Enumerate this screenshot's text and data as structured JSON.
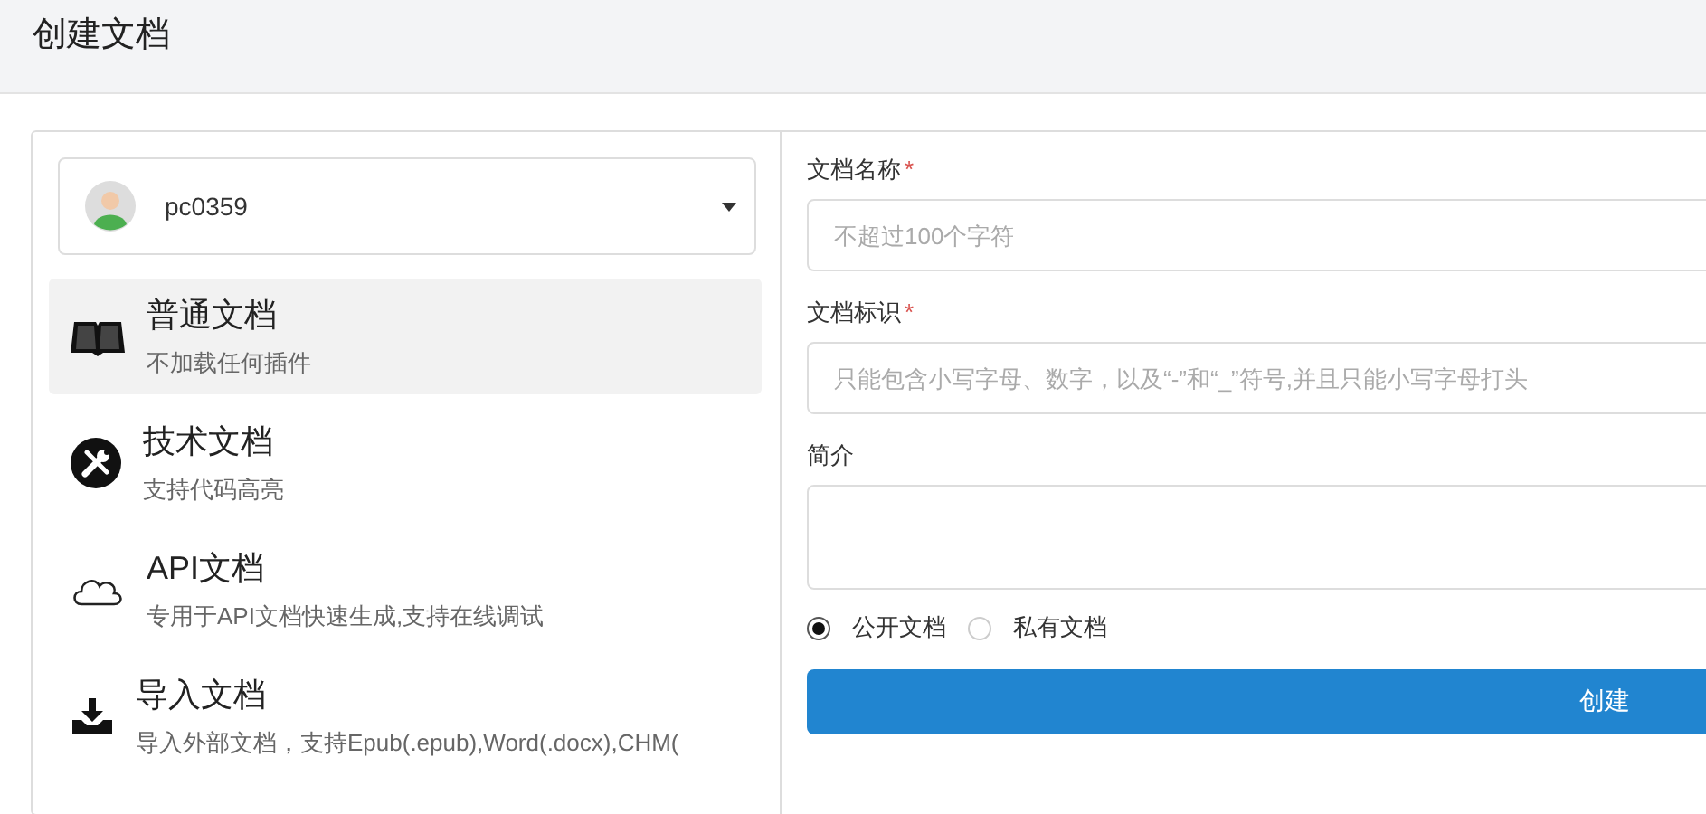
{
  "page_title": "创建文档",
  "account": {
    "name": "pc0359"
  },
  "doc_types": [
    {
      "kind": "normal",
      "title": "普通文档",
      "description": "不加载任何插件",
      "selected": true
    },
    {
      "kind": "tech",
      "title": "技术文档",
      "description": "支持代码高亮",
      "selected": false
    },
    {
      "kind": "api",
      "title": "API文档",
      "description": "专用于API文档快速生成,支持在线调试",
      "selected": false
    },
    {
      "kind": "import",
      "title": "导入文档",
      "description": "导入外部文档，支持Epub(.epub),Word(.docx),CHM(",
      "selected": false
    }
  ],
  "fields": [
    {
      "kind": "input",
      "label": "文档名称",
      "required_mark": "*",
      "placeholder": "不超过100个字符"
    },
    {
      "kind": "input",
      "label": "文档标识",
      "required_mark": "*",
      "placeholder": "只能包含小写字母、数字，以及“-”和“_”符号,并且只能小写字母打头"
    },
    {
      "kind": "textarea",
      "label": "简介"
    }
  ],
  "visibility": [
    {
      "label": "公开文档",
      "selected": true
    },
    {
      "label": "私有文档",
      "selected": false
    }
  ],
  "submit_button": "创建"
}
